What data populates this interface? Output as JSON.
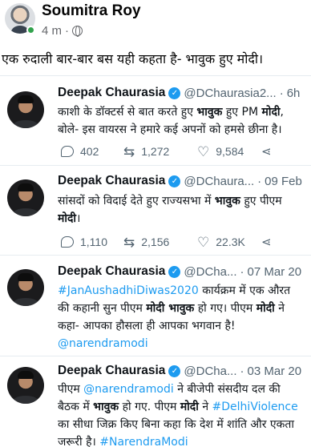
{
  "post": {
    "author": "Soumitra Roy",
    "time": "4 m",
    "separator": "·",
    "caption": "एक रुदाली बार-बार बस यही कहता है- भावुक हुए मोदी।"
  },
  "tweets": [
    {
      "name": "Deepak Chaurasia",
      "handle": "@DChaurasia2...",
      "sep": "·",
      "date": "6h",
      "lines": [
        [
          "काशी के डॉक्टर्स से बात करते हुए ",
          "भावुक",
          " हुए PM ",
          "मोदी",
          ","
        ],
        [
          "बोले- इस वायरस ने हमारे कई अपनों को हमसे छीना है।"
        ]
      ],
      "replies": "402",
      "retweets": "1,272",
      "likes": "9,584"
    },
    {
      "name": "Deepak Chaurasia",
      "handle": "@DChaura...",
      "sep": "·",
      "date": "09 Feb",
      "lines": [
        [
          "सांसदों को विदाई देते हुए राज्यसभा में ",
          "भावुक",
          " हुए पीएम"
        ],
        [
          "",
          "मोदी",
          "।"
        ]
      ],
      "replies": "1,110",
      "retweets": "2,156",
      "likes": "22.3K"
    },
    {
      "name": "Deepak Chaurasia",
      "handle": "@DCha...",
      "sep": "·",
      "date": "07 Mar 20",
      "lines": [
        [
          "#JanAushadhiDiwas2020",
          " कार्यक्रम में एक औरत"
        ],
        [
          "की कहानी सुन पीएम ",
          "मोदी भावुक",
          " हो गए। पीएम ",
          "मोदी",
          " ने"
        ],
        [
          "कहा- आपका हौसला ही आपका भगवान है!"
        ],
        [
          "@narendramodi"
        ]
      ]
    },
    {
      "name": "Deepak Chaurasia",
      "handle": "@DCha...",
      "sep": "·",
      "date": "03 Mar 20",
      "lines": [
        [
          "पीएम ",
          "@narendramodi",
          " ने बीजेपी संसदीय दल की"
        ],
        [
          "बैठक में ",
          "भावुक",
          " हो गए. पीएम ",
          "मोदी",
          " ने ",
          "#DelhiViolence"
        ],
        [
          "का सीधा जिक्र किए बिना कहा कि देश में शांति और एकता"
        ],
        [
          "जरूरी है। ",
          "#NarendraModi"
        ]
      ]
    }
  ]
}
